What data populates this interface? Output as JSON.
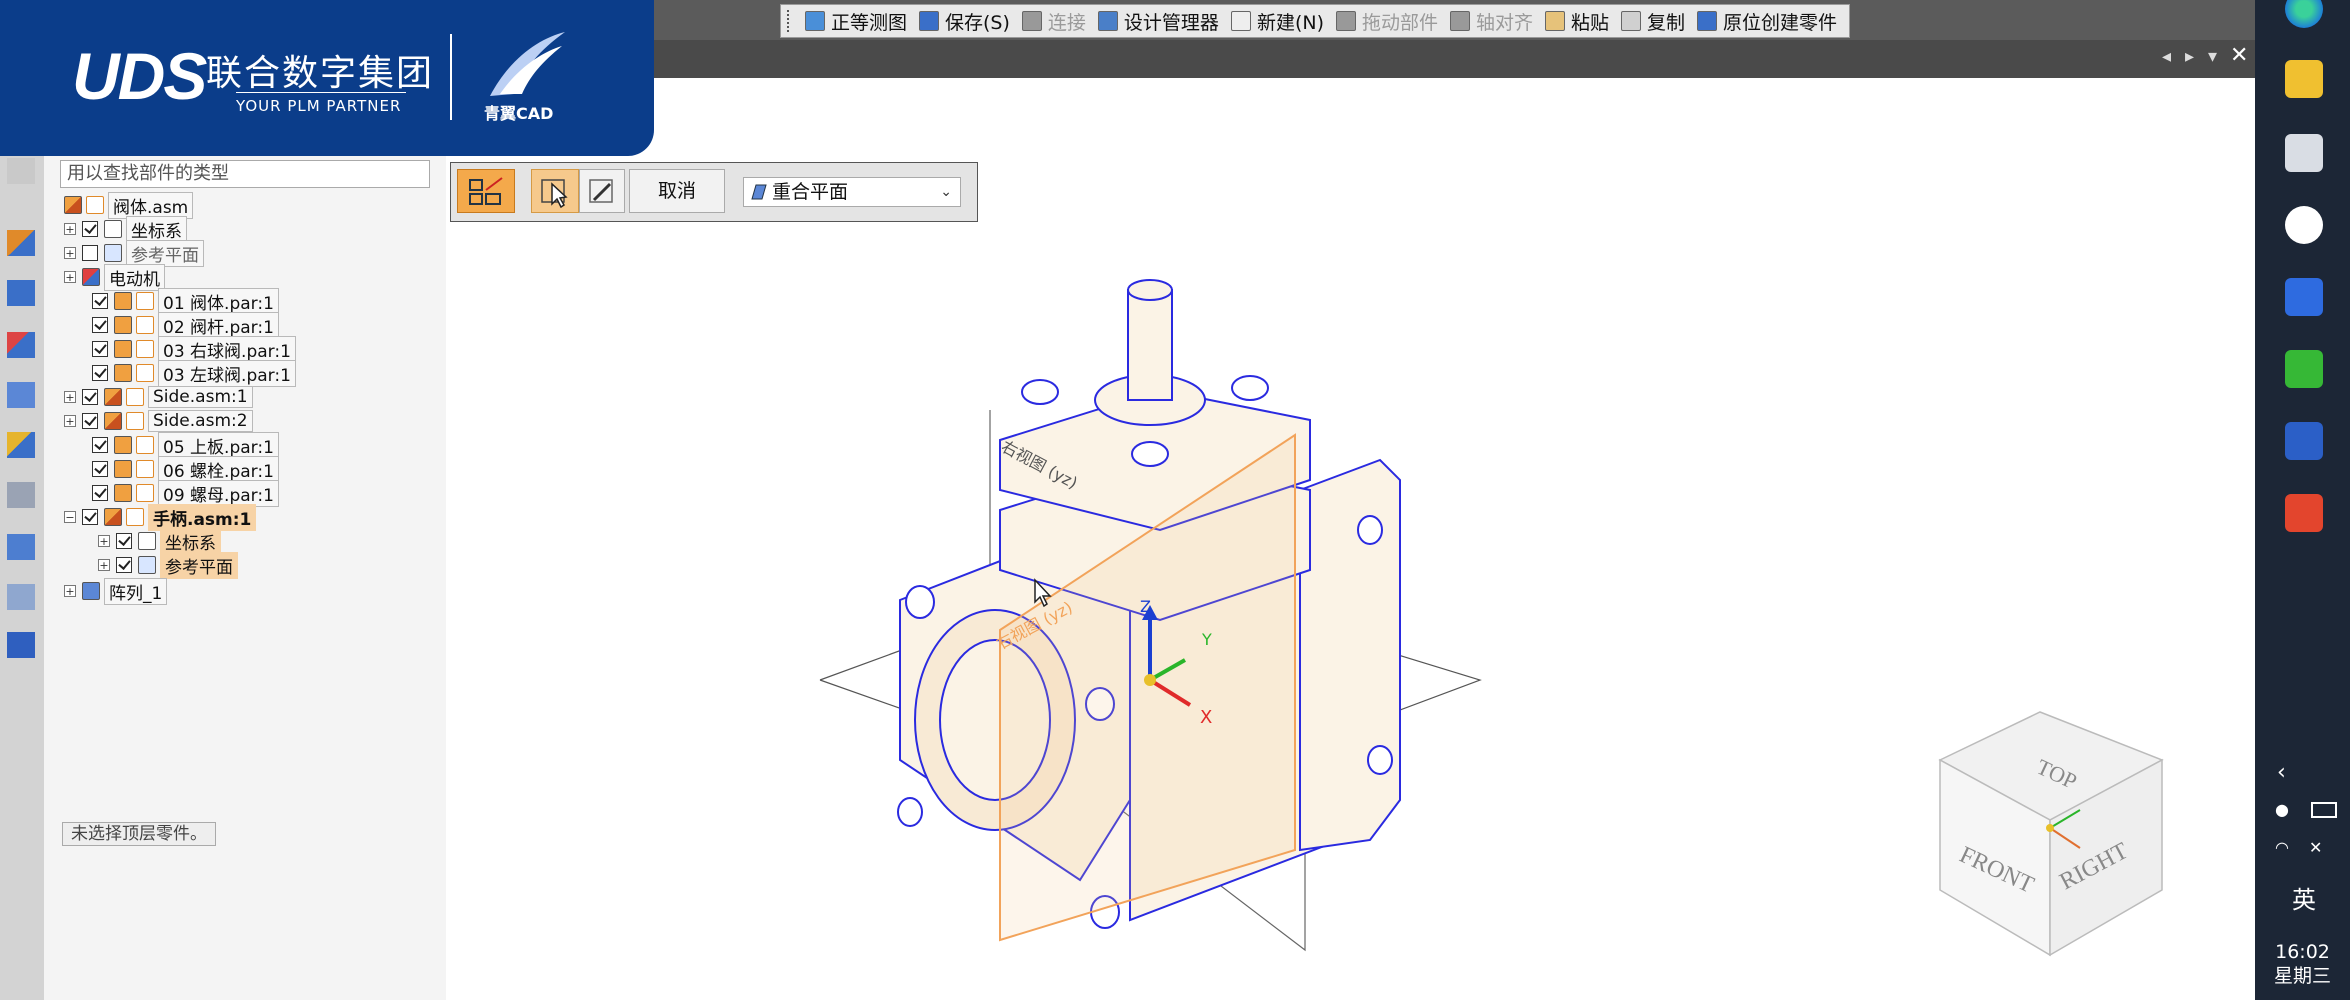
{
  "brand": {
    "company_logo": "UDS",
    "company_cn": "联合数字集团",
    "tagline": "YOUR PLM PARTNER",
    "product": "青翼CAD"
  },
  "toolbar": {
    "items": [
      {
        "label": "正等测图",
        "icon": "iso-view-icon",
        "enabled": true
      },
      {
        "label": "保存(S)",
        "icon": "save-icon",
        "enabled": true
      },
      {
        "label": "连接",
        "icon": "connect-icon",
        "enabled": false
      },
      {
        "label": "设计管理器",
        "icon": "design-manager-icon",
        "enabled": true
      },
      {
        "label": "新建(N)",
        "icon": "new-file-icon",
        "enabled": true
      },
      {
        "label": "拖动部件",
        "icon": "drag-part-icon",
        "enabled": false
      },
      {
        "label": "轴对齐",
        "icon": "axis-align-icon",
        "enabled": false
      },
      {
        "label": "粘贴",
        "icon": "paste-icon",
        "enabled": true
      },
      {
        "label": "复制",
        "icon": "copy-icon",
        "enabled": true
      },
      {
        "label": "原位创建零件",
        "icon": "create-in-place-icon",
        "enabled": true
      }
    ]
  },
  "search": {
    "placeholder": "用以查找部件的类型"
  },
  "tree": [
    {
      "label": "阀体.asm",
      "expand": "",
      "checked": null,
      "icon": "assembly-icon",
      "style": ""
    },
    {
      "label": "坐标系",
      "expand": "+",
      "checked": true,
      "icon": "coordinate-system-icon",
      "style": ""
    },
    {
      "label": "参考平面",
      "expand": "+",
      "checked": false,
      "icon": "reference-plane-icon",
      "style": "gray"
    },
    {
      "label": "电动机",
      "expand": "+",
      "checked": null,
      "icon": "motor-icon",
      "style": ""
    },
    {
      "label": "01 阀体.par:1",
      "expand": "",
      "checked": true,
      "icon": "part-icon",
      "style": ""
    },
    {
      "label": "02 阀杆.par:1",
      "expand": "",
      "checked": true,
      "icon": "part-icon",
      "style": ""
    },
    {
      "label": "03 右球阀.par:1",
      "expand": "",
      "checked": true,
      "icon": "part-icon",
      "style": ""
    },
    {
      "label": "03 左球阀.par:1",
      "expand": "",
      "checked": true,
      "icon": "part-icon",
      "style": ""
    },
    {
      "label": "Side.asm:1",
      "expand": "+",
      "checked": true,
      "icon": "assembly-icon",
      "style": ""
    },
    {
      "label": "Side.asm:2",
      "expand": "+",
      "checked": true,
      "icon": "assembly-icon",
      "style": ""
    },
    {
      "label": "05 上板.par:1",
      "expand": "",
      "checked": true,
      "icon": "part-icon",
      "style": ""
    },
    {
      "label": "06 螺栓.par:1",
      "expand": "",
      "checked": true,
      "icon": "part-icon",
      "style": ""
    },
    {
      "label": "09 螺母.par:1",
      "expand": "",
      "checked": true,
      "icon": "part-icon",
      "style": ""
    },
    {
      "label": "手柄.asm:1",
      "expand": "−",
      "checked": true,
      "icon": "assembly-icon",
      "style": "hl bold"
    },
    {
      "label": "坐标系",
      "expand": "+",
      "checked": true,
      "icon": "coordinate-system-icon",
      "style": "hl",
      "child": true
    },
    {
      "label": "参考平面",
      "expand": "+",
      "checked": true,
      "icon": "reference-plane-icon",
      "style": "hl",
      "child": true
    },
    {
      "label": "阵列_1",
      "expand": "+",
      "checked": null,
      "icon": "pattern-icon",
      "style": ""
    }
  ],
  "status_text": "未选择顶层零件。",
  "command_bar": {
    "cancel_label": "取消",
    "plane_option": "重合平面"
  },
  "viewport": {
    "plane_label_1": "右视图 (yz)",
    "plane_label_2": "右视图 (yz)",
    "axis_z": "Z",
    "axis_y": "Y",
    "axis_x": "X"
  },
  "viewcube": {
    "top": "TOP",
    "front": "FRONT",
    "right": "RIGHT"
  },
  "taskbar": {
    "ime": "英",
    "time": "16:02",
    "weekday": "星期三"
  },
  "colors": {
    "brand_blue": "#0b3d8a",
    "highlight": "#f7d3a6",
    "wire": "#2a2ae0",
    "plane": "#f2a35a",
    "taskbar": "#1c2636"
  }
}
